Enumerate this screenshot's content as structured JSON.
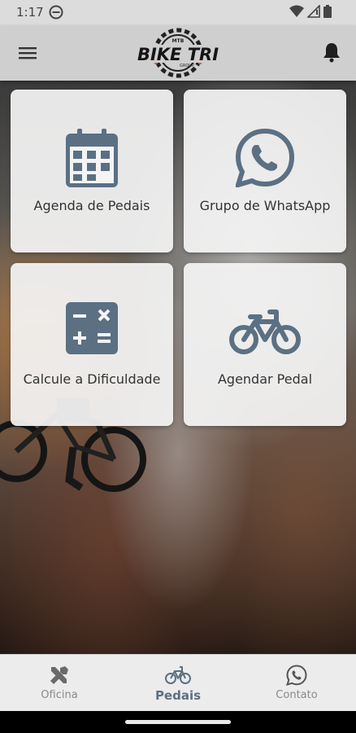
{
  "status_bar": {
    "time": "1:17"
  },
  "app_bar": {
    "logo_text": "BIKE TRI",
    "logo_top_text": "MTB",
    "logo_sub_text": "GROUP"
  },
  "cards": [
    {
      "label": "Agenda de Pedais",
      "icon": "calendar-icon"
    },
    {
      "label": "Grupo de WhatsApp",
      "icon": "whatsapp-icon"
    },
    {
      "label": "Calcule a Dificuldade",
      "icon": "calculator-icon"
    },
    {
      "label": "Agendar Pedal",
      "icon": "bicycle-icon"
    }
  ],
  "bottom_nav": {
    "items": [
      {
        "label": "Oficina",
        "icon": "tools-icon",
        "active": false
      },
      {
        "label": "Pedais",
        "icon": "bicycle-icon",
        "active": true
      },
      {
        "label": "Contato",
        "icon": "whatsapp-icon",
        "active": false
      }
    ]
  },
  "colors": {
    "icon": "#5b7083",
    "card_bg": "#f4f4f4",
    "app_bar": "#cfcfcf",
    "nav_active": "#5b7083",
    "nav_inactive": "#8a8a8a"
  }
}
